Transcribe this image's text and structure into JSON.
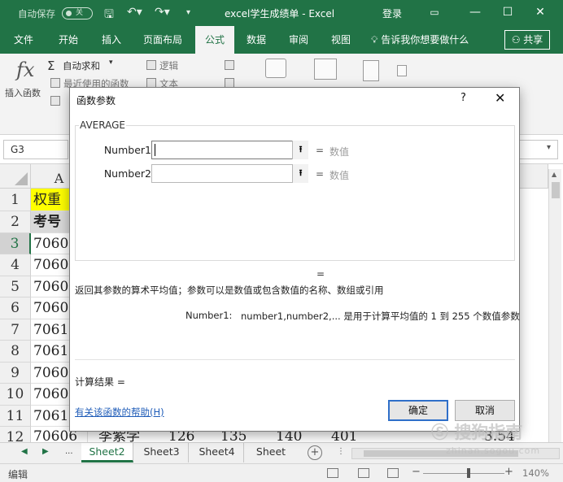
{
  "titlebar": {
    "autosave_label": "自动保存",
    "autosave_state": "关",
    "title": "excel学生成绩单 - Excel",
    "login": "登录"
  },
  "ribbon_tabs": [
    "文件",
    "开始",
    "插入",
    "页面布局",
    "公式",
    "数据",
    "审阅",
    "视图"
  ],
  "active_tab": "公式",
  "tell_me": "告诉我你想要做什么",
  "share": "共享",
  "ribbon": {
    "insert_function": "插入函数",
    "autosum": "自动求和",
    "recent": "最近使用的函数",
    "logical": "逻辑",
    "text": "文本"
  },
  "formula_bar": {
    "name_box": "G3"
  },
  "grid": {
    "column_a": "A",
    "rows": [
      {
        "n": "1",
        "a": "权重"
      },
      {
        "n": "2",
        "a": "考号"
      },
      {
        "n": "3",
        "a": "7060"
      },
      {
        "n": "4",
        "a": "7060"
      },
      {
        "n": "5",
        "a": "7060"
      },
      {
        "n": "6",
        "a": "7060"
      },
      {
        "n": "7",
        "a": "7061"
      },
      {
        "n": "8",
        "a": "7061"
      },
      {
        "n": "9",
        "a": "7060"
      },
      {
        "n": "10",
        "a": "7060"
      },
      {
        "n": "11",
        "a": "7061"
      },
      {
        "n": "12",
        "a": "70606"
      }
    ],
    "row12_extra": [
      "李紫学",
      "126",
      "135",
      "140",
      "401",
      "3.54"
    ]
  },
  "sheets": [
    "Sheet2",
    "Sheet3",
    "Sheet4",
    "Sheet"
  ],
  "active_sheet": "Sheet2",
  "status": {
    "mode": "编辑",
    "zoom": "140%"
  },
  "dialog": {
    "title": "函数参数",
    "help_glyph": "?",
    "function_name": "AVERAGE",
    "args": [
      {
        "label": "Number1",
        "value": "",
        "hint": "数值"
      },
      {
        "label": "Number2",
        "value": "",
        "hint": "数值"
      }
    ],
    "equals": "=",
    "result_equals": "=",
    "description": "返回其参数的算术平均值；参数可以是数值或包含数值的名称、数组或引用",
    "arg_desc_name": "Number1:",
    "arg_desc_text": "number1,number2,... 是用于计算平均值的 1 到 255 个数值参数",
    "calc_result": "计算结果 =",
    "help_link": "有关该函数的帮助(H)",
    "ok": "确定",
    "cancel": "取消"
  },
  "watermark": {
    "brand": "搜狗指南",
    "url": "zhinan.sogou.com"
  }
}
